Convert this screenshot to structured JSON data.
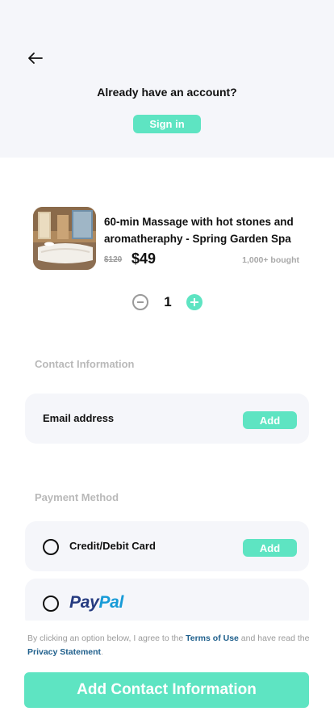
{
  "header": {
    "back_icon": "arrow-left-icon",
    "account_prompt": "Already have an account?",
    "signin_label": "Sign in"
  },
  "product": {
    "image_icon": "spa-room-photo",
    "title": "60-min Massage with hot stones and aromatheraphy - Spring Garden Spa",
    "old_price": "$120",
    "price": "$49",
    "bought": "1,000+ bought"
  },
  "quantity": {
    "value": "1",
    "minus_icon": "minus-circle-icon",
    "plus_icon": "plus-circle-icon"
  },
  "contact": {
    "section_label": "Contact Information",
    "email_label": "Email address",
    "add_label": "Add"
  },
  "payment": {
    "section_label": "Payment Method",
    "card_label": "Credit/Debit Card",
    "card_add_label": "Add",
    "paypal_pay": "Pay",
    "paypal_pal": "Pal"
  },
  "footer": {
    "terms_prefix": "By clicking an option below, I agree to the ",
    "terms_link": "Terms of Use",
    "terms_mid": " and have read the ",
    "privacy_link": "Privacy Statement",
    "terms_suffix": ".",
    "cta_label": "Add Contact Information"
  },
  "colors": {
    "accent": "#5ee4c2",
    "header_bg": "#f5f6fa",
    "card_bg": "#f5f6fa",
    "muted": "#b9b9b9",
    "link": "#1e5f8c",
    "paypal_dark": "#253b80",
    "paypal_light": "#179bd7"
  }
}
